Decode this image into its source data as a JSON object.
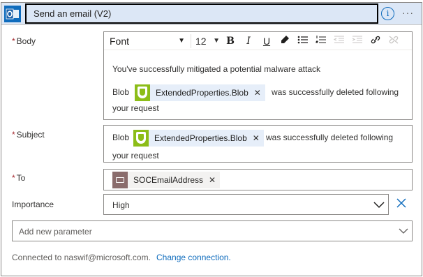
{
  "header": {
    "title": "Send an email (V2)",
    "app_icon": "outlook-icon",
    "info_icon": "info-icon",
    "more_icon": "more-options-icon",
    "accent_color": "#dce7f6"
  },
  "body_field": {
    "label": "Body",
    "required_mark": "*",
    "toolbar": {
      "font": "Font",
      "size": "12",
      "bold": "B",
      "italic": "I",
      "underline": "U"
    },
    "line1": "You've successfully mitigated a potential malware attack",
    "line2_prefix": "Blob",
    "token": "ExtendedProperties.Blob",
    "line2_suffix": "was successfully deleted following",
    "line3": "your request"
  },
  "subject_field": {
    "label": "Subject",
    "required_mark": "*",
    "prefix": "Blob",
    "token": "ExtendedProperties.Blob",
    "suffix": "was successfully deleted following",
    "line2": "your request"
  },
  "to_field": {
    "label": "To",
    "required_mark": "*",
    "token": "SOCEmailAddress"
  },
  "importance_field": {
    "label": "Importance",
    "value": "High"
  },
  "add_parameter": {
    "placeholder": "Add new parameter"
  },
  "footer": {
    "connected_text": "Connected to naswif@microsoft.com.",
    "change_link": "Change connection."
  }
}
